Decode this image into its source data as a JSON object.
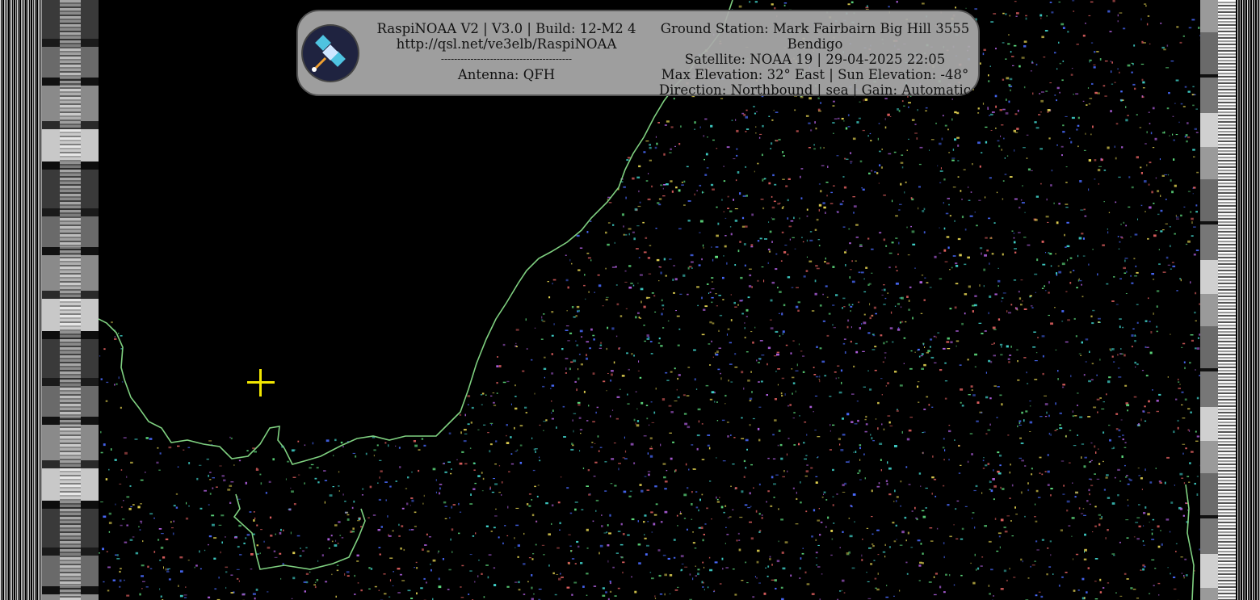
{
  "panel": {
    "left": {
      "line1": "RaspiNOAA V2 | V3.0 | Build: 12-M2 4",
      "line2": "http://qsl.net/ve3elb/RaspiNOAA",
      "line3": "----------------------------------------",
      "line4": "Antenna: QFH"
    },
    "right": {
      "line1": "Ground Station: Mark Fairbairn Big Hill 3555",
      "line2": "Bendigo",
      "line3": "Satellite: NOAA 19 | 29-04-2025 22:05",
      "line4": "Max Elevation: 32° East | Sun Elevation: -48°",
      "line5": "Direction: Northbound | sea | Gain: Automatic"
    }
  },
  "colors": {
    "coastline": "#7fd080",
    "crosshair": "#f2e600",
    "speckle": [
      "#4a6bff",
      "#3fd0c8",
      "#b060e0",
      "#e0d050",
      "#60e080",
      "#e06060"
    ]
  },
  "icons": {
    "logo": "satellite-logo-icon",
    "marker": "crosshair-icon"
  }
}
